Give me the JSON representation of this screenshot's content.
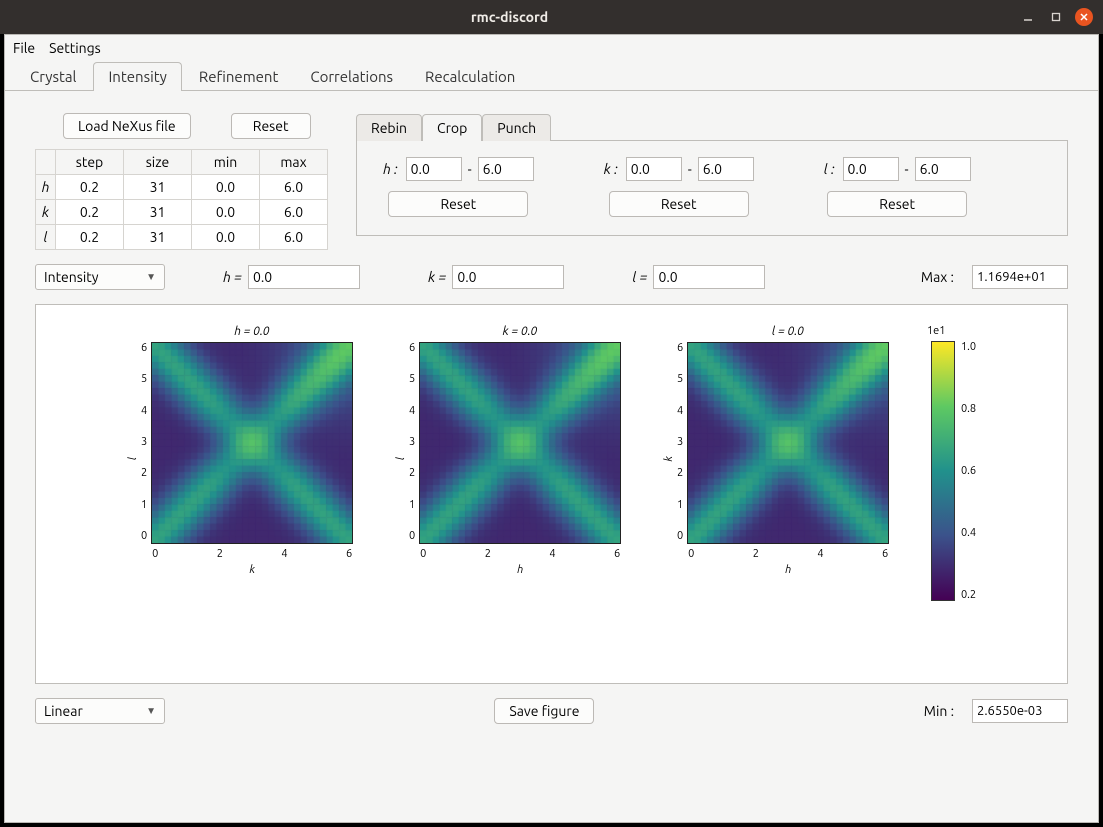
{
  "window": {
    "title": "rmc-discord"
  },
  "menu": {
    "items": [
      "File",
      "Settings"
    ]
  },
  "tabs": {
    "items": [
      "Crystal",
      "Intensity",
      "Refinement",
      "Correlations",
      "Recalculation"
    ],
    "active": "Intensity"
  },
  "toolbar": {
    "load": "Load NeXus file",
    "reset": "Reset"
  },
  "gridTable": {
    "headers": [
      "",
      "step",
      "size",
      "min",
      "max"
    ],
    "rows": [
      {
        "axis": "h",
        "step": "0.2",
        "size": "31",
        "min": "0.0",
        "max": "6.0"
      },
      {
        "axis": "k",
        "step": "0.2",
        "size": "31",
        "min": "0.0",
        "max": "6.0"
      },
      {
        "axis": "l",
        "step": "0.2",
        "size": "31",
        "min": "0.0",
        "max": "6.0"
      }
    ]
  },
  "innerTabs": {
    "items": [
      "Rebin",
      "Crop",
      "Punch"
    ],
    "active": "Crop"
  },
  "crop": {
    "h": {
      "label": "h :",
      "lo": "0.0",
      "dash": "-",
      "hi": "6.0",
      "reset": "Reset"
    },
    "k": {
      "label": "k :",
      "lo": "0.0",
      "dash": "-",
      "hi": "6.0",
      "reset": "Reset"
    },
    "l": {
      "label": "l :",
      "lo": "0.0",
      "dash": "-",
      "hi": "6.0",
      "reset": "Reset"
    }
  },
  "sliceSel": {
    "mode": "Intensity",
    "h": {
      "label": "h =",
      "val": "0.0"
    },
    "k": {
      "label": "k =",
      "val": "0.0"
    },
    "l": {
      "label": "l =",
      "val": "0.0"
    },
    "maxLabel": "Max :",
    "max": "1.1694e+01"
  },
  "plots": {
    "p1": {
      "title": "h = 0.0",
      "xlabel": "k",
      "ylabel": "l"
    },
    "p2": {
      "title": "k = 0.0",
      "xlabel": "h",
      "ylabel": "l"
    },
    "p3": {
      "title": "l = 0.0",
      "xlabel": "h",
      "ylabel": "k"
    },
    "yticks": [
      "6",
      "5",
      "4",
      "3",
      "2",
      "1",
      "0"
    ],
    "xticks": [
      "0",
      "2",
      "4",
      "6"
    ],
    "cb": {
      "exp": "1e1",
      "ticks": [
        "1.0",
        "0.8",
        "0.6",
        "0.4",
        "0.2"
      ]
    }
  },
  "bottom": {
    "scale": "Linear",
    "save": "Save figure",
    "minLabel": "Min :",
    "min": "2.6550e-03"
  },
  "chart_data": {
    "type": "heatmap",
    "note": "Three reciprocal-space intensity slices on a 0..6 × 0..6 grid (step 0.2, 31×31). Values scaled ×1e1; min 2.6550e-03, max 1.1694e+01. Pixel-level data not individually readable; summary ranges recorded.",
    "slices": [
      {
        "fixed_axis": "h",
        "fixed_value": 0.0,
        "x_axis": "k",
        "y_axis": "l",
        "x_range": [
          0,
          6
        ],
        "y_range": [
          0,
          6
        ]
      },
      {
        "fixed_axis": "k",
        "fixed_value": 0.0,
        "x_axis": "h",
        "y_axis": "l",
        "x_range": [
          0,
          6
        ],
        "y_range": [
          0,
          6
        ]
      },
      {
        "fixed_axis": "l",
        "fixed_value": 0.0,
        "x_axis": "h",
        "y_axis": "k",
        "x_range": [
          0,
          6
        ],
        "y_range": [
          0,
          6
        ]
      }
    ],
    "colorbar_range": [
      0,
      11.694
    ],
    "colormap": "viridis"
  }
}
